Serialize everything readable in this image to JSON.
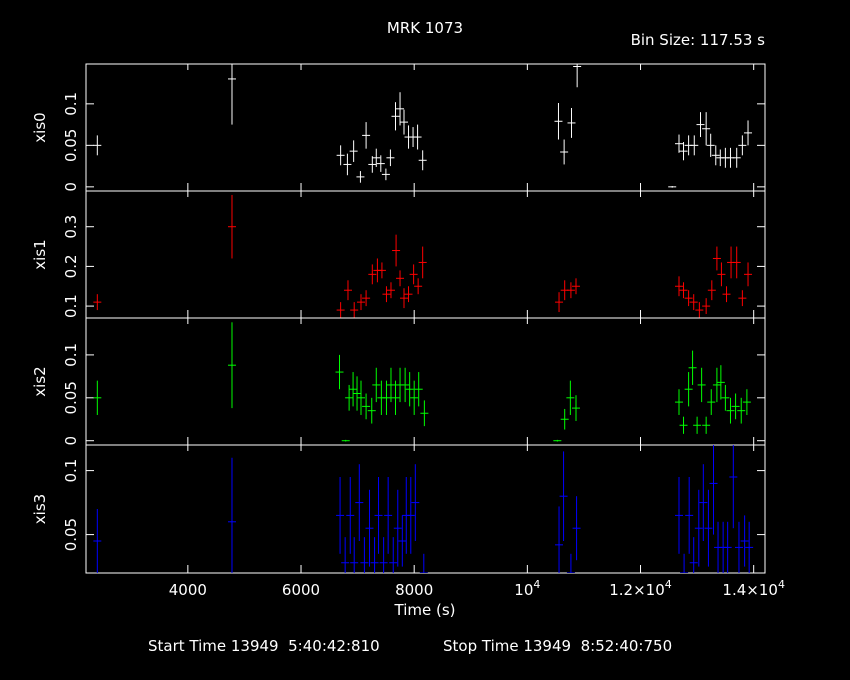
{
  "title": "MRK 1073",
  "bin_size_label": "Bin Size: 117.53 s",
  "footer": {
    "start_label": "Start Time 13949  5:40:42:810",
    "stop_label": "Stop Time 13949  8:52:40:750"
  },
  "chart_data": {
    "type": "scatter",
    "title": "MRK 1073",
    "xlabel": "Time (s)",
    "xlim": [
      2200,
      14200
    ],
    "x_tick_labels": [
      "4000",
      "6000",
      "8000",
      "10^4",
      "1.2×10^4",
      "1.4×10^4"
    ],
    "x_tick_values": [
      4000,
      6000,
      8000,
      10000,
      12000,
      14000
    ],
    "panels": [
      {
        "name": "xis0",
        "color": "#ffffff",
        "ylim": [
          -0.005,
          0.148
        ],
        "y_tick_labels": [
          "0",
          "0.05",
          "0.1"
        ],
        "y_tick_values": [
          0,
          0.05,
          0.1
        ],
        "points": [
          [
            2400,
            0.05,
            0.012
          ],
          [
            4780,
            0.13,
            0.055
          ],
          [
            6700,
            0.038,
            0.012
          ],
          [
            6820,
            0.027,
            0.013
          ],
          [
            6930,
            0.043,
            0.013
          ],
          [
            7050,
            0.012,
            0.007
          ],
          [
            7150,
            0.062,
            0.016
          ],
          [
            7260,
            0.027,
            0.01
          ],
          [
            7330,
            0.035,
            0.011
          ],
          [
            7410,
            0.028,
            0.01
          ],
          [
            7500,
            0.015,
            0.007
          ],
          [
            7580,
            0.035,
            0.01
          ],
          [
            7670,
            0.085,
            0.017
          ],
          [
            7750,
            0.094,
            0.02
          ],
          [
            7820,
            0.078,
            0.015
          ],
          [
            7900,
            0.06,
            0.014
          ],
          [
            7980,
            0.06,
            0.012
          ],
          [
            8060,
            0.06,
            0.015
          ],
          [
            8150,
            0.032,
            0.012
          ],
          [
            10550,
            0.079,
            0.022
          ],
          [
            10650,
            0.042,
            0.015
          ],
          [
            10780,
            0.077,
            0.018
          ],
          [
            10880,
            0.145,
            0.025
          ],
          [
            12560,
            0.0,
            0.001
          ],
          [
            12680,
            0.052,
            0.011
          ],
          [
            12760,
            0.043,
            0.011
          ],
          [
            12850,
            0.05,
            0.012
          ],
          [
            12950,
            0.05,
            0.012
          ],
          [
            13060,
            0.075,
            0.015
          ],
          [
            13160,
            0.07,
            0.02
          ],
          [
            13240,
            0.05,
            0.014
          ],
          [
            13330,
            0.038,
            0.012
          ],
          [
            13410,
            0.035,
            0.01
          ],
          [
            13500,
            0.035,
            0.012
          ],
          [
            13590,
            0.035,
            0.012
          ],
          [
            13700,
            0.035,
            0.012
          ],
          [
            13800,
            0.05,
            0.012
          ],
          [
            13900,
            0.065,
            0.015
          ]
        ]
      },
      {
        "name": "xis1",
        "color": "#ff0000",
        "ylim": [
          0.07,
          0.39
        ],
        "y_tick_labels": [
          "0.1",
          "0.2",
          "0.3"
        ],
        "y_tick_values": [
          0.1,
          0.2,
          0.3
        ],
        "points": [
          [
            2400,
            0.11,
            0.02
          ],
          [
            4780,
            0.3,
            0.08
          ],
          [
            6700,
            0.09,
            0.02
          ],
          [
            6830,
            0.14,
            0.025
          ],
          [
            6940,
            0.09,
            0.02
          ],
          [
            7060,
            0.11,
            0.02
          ],
          [
            7150,
            0.12,
            0.02
          ],
          [
            7260,
            0.18,
            0.025
          ],
          [
            7350,
            0.19,
            0.03
          ],
          [
            7430,
            0.19,
            0.02
          ],
          [
            7510,
            0.13,
            0.02
          ],
          [
            7590,
            0.14,
            0.02
          ],
          [
            7680,
            0.24,
            0.04
          ],
          [
            7750,
            0.17,
            0.02
          ],
          [
            7820,
            0.12,
            0.025
          ],
          [
            7900,
            0.13,
            0.02
          ],
          [
            7990,
            0.18,
            0.025
          ],
          [
            8070,
            0.15,
            0.02
          ],
          [
            8150,
            0.21,
            0.04
          ],
          [
            10560,
            0.11,
            0.025
          ],
          [
            10660,
            0.14,
            0.025
          ],
          [
            10770,
            0.14,
            0.02
          ],
          [
            10860,
            0.15,
            0.02
          ],
          [
            12680,
            0.15,
            0.025
          ],
          [
            12760,
            0.14,
            0.02
          ],
          [
            12850,
            0.12,
            0.02
          ],
          [
            12940,
            0.11,
            0.02
          ],
          [
            13040,
            0.09,
            0.02
          ],
          [
            13160,
            0.1,
            0.02
          ],
          [
            13260,
            0.14,
            0.025
          ],
          [
            13350,
            0.22,
            0.03
          ],
          [
            13430,
            0.18,
            0.03
          ],
          [
            13520,
            0.13,
            0.02
          ],
          [
            13600,
            0.21,
            0.04
          ],
          [
            13700,
            0.21,
            0.04
          ],
          [
            13800,
            0.12,
            0.02
          ],
          [
            13900,
            0.18,
            0.03
          ]
        ]
      },
      {
        "name": "xis2",
        "color": "#00ff00",
        "ylim": [
          -0.005,
          0.143
        ],
        "y_tick_labels": [
          "0",
          "0.05",
          "0.1"
        ],
        "y_tick_values": [
          0,
          0.05,
          0.1
        ],
        "points": [
          [
            2400,
            0.05,
            0.02
          ],
          [
            4780,
            0.088,
            0.05
          ],
          [
            6680,
            0.08,
            0.02
          ],
          [
            6790,
            0.0,
            0.001
          ],
          [
            6850,
            0.05,
            0.015
          ],
          [
            6920,
            0.06,
            0.02
          ],
          [
            6990,
            0.055,
            0.02
          ],
          [
            7060,
            0.05,
            0.02
          ],
          [
            7150,
            0.04,
            0.015
          ],
          [
            7250,
            0.035,
            0.015
          ],
          [
            7330,
            0.065,
            0.02
          ],
          [
            7420,
            0.05,
            0.02
          ],
          [
            7510,
            0.05,
            0.02
          ],
          [
            7590,
            0.065,
            0.02
          ],
          [
            7670,
            0.05,
            0.02
          ],
          [
            7750,
            0.065,
            0.02
          ],
          [
            7840,
            0.065,
            0.02
          ],
          [
            7920,
            0.06,
            0.02
          ],
          [
            8000,
            0.05,
            0.02
          ],
          [
            8080,
            0.06,
            0.02
          ],
          [
            8180,
            0.032,
            0.015
          ],
          [
            10530,
            0.0,
            0.001
          ],
          [
            10660,
            0.025,
            0.012
          ],
          [
            10760,
            0.05,
            0.02
          ],
          [
            10860,
            0.038,
            0.015
          ],
          [
            12680,
            0.045,
            0.015
          ],
          [
            12760,
            0.018,
            0.01
          ],
          [
            12850,
            0.06,
            0.02
          ],
          [
            12920,
            0.085,
            0.02
          ],
          [
            13000,
            0.018,
            0.01
          ],
          [
            13080,
            0.065,
            0.02
          ],
          [
            13160,
            0.018,
            0.01
          ],
          [
            13250,
            0.045,
            0.015
          ],
          [
            13350,
            0.065,
            0.02
          ],
          [
            13420,
            0.068,
            0.02
          ],
          [
            13500,
            0.05,
            0.015
          ],
          [
            13590,
            0.035,
            0.015
          ],
          [
            13680,
            0.04,
            0.015
          ],
          [
            13780,
            0.035,
            0.015
          ],
          [
            13880,
            0.045,
            0.015
          ]
        ]
      },
      {
        "name": "xis3",
        "color": "#0000ff",
        "ylim": [
          0.02,
          0.12
        ],
        "y_tick_labels": [
          "0.05",
          "0.1"
        ],
        "y_tick_values": [
          0.05,
          0.1
        ],
        "points": [
          [
            2400,
            0.045,
            0.025
          ],
          [
            4780,
            0.06,
            0.05
          ],
          [
            6690,
            0.065,
            0.03
          ],
          [
            6780,
            0.028,
            0.02
          ],
          [
            6870,
            0.065,
            0.03
          ],
          [
            6940,
            0.028,
            0.02
          ],
          [
            7030,
            0.075,
            0.03
          ],
          [
            7120,
            0.028,
            0.02
          ],
          [
            7210,
            0.055,
            0.03
          ],
          [
            7300,
            0.028,
            0.02
          ],
          [
            7370,
            0.065,
            0.03
          ],
          [
            7460,
            0.028,
            0.02
          ],
          [
            7540,
            0.065,
            0.03
          ],
          [
            7630,
            0.028,
            0.02
          ],
          [
            7710,
            0.055,
            0.03
          ],
          [
            7790,
            0.045,
            0.02
          ],
          [
            7860,
            0.065,
            0.03
          ],
          [
            7940,
            0.065,
            0.03
          ],
          [
            8020,
            0.075,
            0.03
          ],
          [
            8170,
            0.02,
            0.015
          ],
          [
            10560,
            0.042,
            0.03
          ],
          [
            10640,
            0.08,
            0.035
          ],
          [
            10770,
            0.02,
            0.015
          ],
          [
            10870,
            0.055,
            0.025
          ],
          [
            12680,
            0.065,
            0.03
          ],
          [
            12770,
            0.02,
            0.015
          ],
          [
            12860,
            0.065,
            0.03
          ],
          [
            12940,
            0.028,
            0.02
          ],
          [
            13030,
            0.055,
            0.03
          ],
          [
            13110,
            0.075,
            0.03
          ],
          [
            13200,
            0.055,
            0.03
          ],
          [
            13290,
            0.09,
            0.04
          ],
          [
            13370,
            0.04,
            0.02
          ],
          [
            13460,
            0.04,
            0.02
          ],
          [
            13540,
            0.04,
            0.02
          ],
          [
            13640,
            0.095,
            0.04
          ],
          [
            13740,
            0.04,
            0.02
          ],
          [
            13840,
            0.045,
            0.02
          ],
          [
            13920,
            0.04,
            0.02
          ]
        ]
      }
    ]
  }
}
